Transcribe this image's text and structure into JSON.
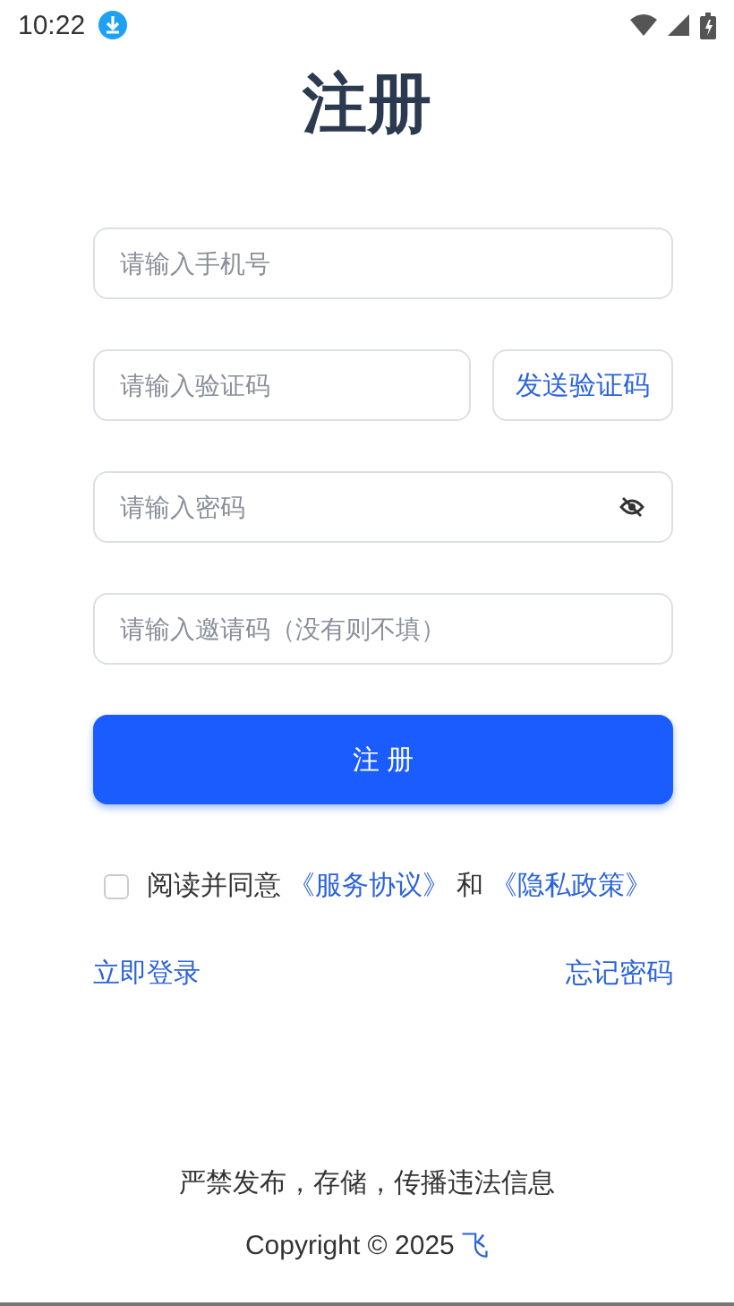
{
  "status_bar": {
    "time": "10:22"
  },
  "title": "注册",
  "fields": [
    {
      "kind": "text",
      "placeholder": "请输入手机号"
    },
    {
      "kind": "code",
      "placeholder": "请输入验证码",
      "button": "发送验证码"
    },
    {
      "kind": "password",
      "placeholder": "请输入密码"
    },
    {
      "kind": "text",
      "placeholder": "请输入邀请码（没有则不填）"
    }
  ],
  "submit": "注 册",
  "agreement": {
    "checked": false,
    "parts": [
      {
        "kind": "text",
        "text": "阅读并同意"
      },
      {
        "kind": "link",
        "text": "《服务协议》"
      },
      {
        "kind": "text",
        "text": "和"
      },
      {
        "kind": "link",
        "text": "《隐私政策》"
      }
    ]
  },
  "links": {
    "left": "立即登录",
    "right": "忘记密码"
  },
  "footer": {
    "notice": "严禁发布，存储，传播违法信息",
    "copyright": "Copyright © 2025",
    "company": "飞"
  }
}
